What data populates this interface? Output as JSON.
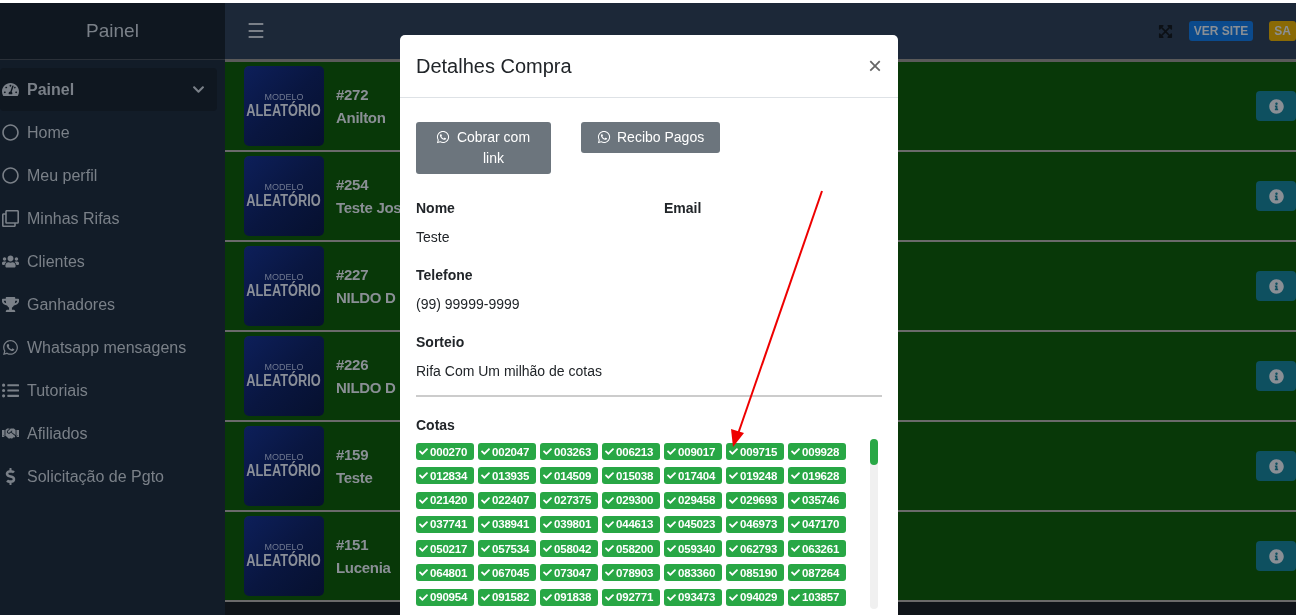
{
  "sidebar": {
    "brand": "Painel",
    "items": [
      {
        "label": "Painel",
        "selected": true,
        "expanded": true
      },
      {
        "label": "Home",
        "selected": false
      },
      {
        "label": "Meu perfil",
        "selected": false
      },
      {
        "label": "Minhas Rifas",
        "selected": false
      },
      {
        "label": "Clientes",
        "selected": false
      },
      {
        "label": "Ganhadores",
        "selected": false
      },
      {
        "label": "Whatsapp mensagens",
        "selected": false
      },
      {
        "label": "Tutoriais",
        "selected": false
      },
      {
        "label": "Afiliados",
        "selected": false
      },
      {
        "label": "Solicitação de Pgto",
        "selected": false
      }
    ]
  },
  "topbar": {
    "menu_glyph": "☰",
    "badges": [
      {
        "label": "VER SITE",
        "color": "#0b4a8c"
      },
      {
        "label": "SA",
        "color": "#8a6a05"
      }
    ]
  },
  "raffles": [
    {
      "number": "#272",
      "name": "Anilton",
      "thumb_top": "MODELO",
      "thumb_main": "ALEATÓRIO"
    },
    {
      "number": "#254",
      "name": "Teste Jos",
      "thumb_top": "MODELO",
      "thumb_main": "ALEATÓRIO"
    },
    {
      "number": "#227",
      "name": "NILDO D",
      "thumb_top": "MODELO",
      "thumb_main": "ALEATÓRIO"
    },
    {
      "number": "#226",
      "name": "NILDO D",
      "thumb_top": "MODELO",
      "thumb_main": "ALEATÓRIO"
    },
    {
      "number": "#159",
      "name": "Teste",
      "thumb_top": "MODELO",
      "thumb_main": "ALEATÓRIO"
    },
    {
      "number": "#151",
      "name": "Lucenia",
      "thumb_top": "MODELO",
      "thumb_main": "ALEATÓRIO"
    }
  ],
  "modal": {
    "title": "Detalhes Compra",
    "close": "×",
    "buttons": [
      "Cobrar com link",
      "Recibo Pagos"
    ],
    "field_rows": [
      [
        {
          "label": "Nome",
          "value": "Teste"
        },
        {
          "label": "Email"
        }
      ],
      [
        {
          "label": "Telefone",
          "value": "(99) 99999-9999"
        }
      ],
      [
        {
          "label": "Sorteio",
          "value": "Rifa Com Um milhão de cotas"
        }
      ]
    ],
    "cotas_label": "Cotas",
    "cotas": [
      "000270",
      "002047",
      "003263",
      "006213",
      "009017",
      "009715",
      "009928",
      "012834",
      "013935",
      "014509",
      "015038",
      "017404",
      "019248",
      "019628",
      "021420",
      "022407",
      "027375",
      "029300",
      "029458",
      "029693",
      "035746",
      "037741",
      "038941",
      "039801",
      "044613",
      "045023",
      "046973",
      "047170",
      "050217",
      "057534",
      "058042",
      "058200",
      "059340",
      "062793",
      "063261",
      "064801",
      "067045",
      "073047",
      "078903",
      "083360",
      "085190",
      "087264",
      "090954",
      "091582",
      "091838",
      "092771",
      "093473",
      "094029",
      "103857"
    ]
  }
}
